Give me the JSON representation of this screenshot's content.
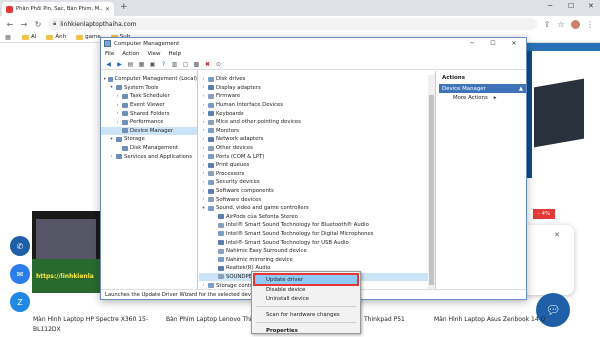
{
  "browser": {
    "tab_title": "Phân Phối Pin, Sạc, Bàn Phím, M...",
    "url": "linhkienlaptopthaiha.com",
    "bookmarks": [
      "AI",
      "Ảnh",
      "game",
      "Sub"
    ]
  },
  "site": {
    "watermark": "https://linhkienla",
    "discount": "- 4%",
    "captions": [
      "Màn Hình Laptop HP Spectre X360 15-",
      "Bàn Phím Laptop Lenovo Think",
      "Thinkpad P51",
      "Màn Hình Laptop Asus Zenbook 14 Q"
    ],
    "caption_line2": "BL112DX"
  },
  "cm": {
    "title": "Computer Management",
    "menu": [
      "File",
      "Action",
      "View",
      "Help"
    ],
    "left_tree": [
      {
        "label": "Computer Management (Local)",
        "level": 0,
        "arrow": "▾"
      },
      {
        "label": "System Tools",
        "level": 1,
        "arrow": "▾"
      },
      {
        "label": "Task Scheduler",
        "level": 2,
        "arrow": "›"
      },
      {
        "label": "Event Viewer",
        "level": 2,
        "arrow": "›"
      },
      {
        "label": "Shared Folders",
        "level": 2,
        "arrow": "›"
      },
      {
        "label": "Performance",
        "level": 2,
        "arrow": "›"
      },
      {
        "label": "Device Manager",
        "level": 2,
        "arrow": "",
        "selected": true
      },
      {
        "label": "Storage",
        "level": 1,
        "arrow": "▾"
      },
      {
        "label": "Disk Management",
        "level": 2,
        "arrow": ""
      },
      {
        "label": "Services and Applications",
        "level": 1,
        "arrow": "›"
      }
    ],
    "device_tree": [
      {
        "label": "Disk drives",
        "level": 0,
        "arrow": "›"
      },
      {
        "label": "Display adapters",
        "level": 0,
        "arrow": "›"
      },
      {
        "label": "Firmware",
        "level": 0,
        "arrow": "›"
      },
      {
        "label": "Human Interface Devices",
        "level": 0,
        "arrow": "›"
      },
      {
        "label": "Keyboards",
        "level": 0,
        "arrow": "›"
      },
      {
        "label": "Mice and other pointing devices",
        "level": 0,
        "arrow": "›"
      },
      {
        "label": "Monitors",
        "level": 0,
        "arrow": "›"
      },
      {
        "label": "Network adapters",
        "level": 0,
        "arrow": "›"
      },
      {
        "label": "Other devices",
        "level": 0,
        "arrow": "›"
      },
      {
        "label": "Ports (COM & LPT)",
        "level": 0,
        "arrow": "›"
      },
      {
        "label": "Print queues",
        "level": 0,
        "arrow": "›"
      },
      {
        "label": "Processors",
        "level": 0,
        "arrow": "›"
      },
      {
        "label": "Security devices",
        "level": 0,
        "arrow": "›"
      },
      {
        "label": "Software components",
        "level": 0,
        "arrow": "›"
      },
      {
        "label": "Software devices",
        "level": 0,
        "arrow": "›"
      },
      {
        "label": "Sound, video and game controllers",
        "level": 0,
        "arrow": "▾"
      },
      {
        "label": "AirPods của Sefonta Stereo",
        "level": 1,
        "arrow": ""
      },
      {
        "label": "Intel® Smart Sound Technology for Bluetooth® Audio",
        "level": 1,
        "arrow": ""
      },
      {
        "label": "Intel® Smart Sound Technology for Digital Microphones",
        "level": 1,
        "arrow": ""
      },
      {
        "label": "Intel® Smart Sound Technology for USB Audio",
        "level": 1,
        "arrow": ""
      },
      {
        "label": "Nahimic Easy Surround device",
        "level": 1,
        "arrow": ""
      },
      {
        "label": "Nahimic mirroring device",
        "level": 1,
        "arrow": ""
      },
      {
        "label": "Realtek(R) Audio",
        "level": 1,
        "arrow": ""
      },
      {
        "label": "SOUNDPEATS",
        "level": 1,
        "arrow": "",
        "selected": true
      },
      {
        "label": "Storage contr",
        "level": 0,
        "arrow": "›"
      },
      {
        "label": "System devic",
        "level": 0,
        "arrow": "›"
      },
      {
        "label": "Universal Seri",
        "level": 0,
        "arrow": "›"
      }
    ],
    "actions": {
      "header": "Actions",
      "selected": "Device Manager",
      "more": "More Actions"
    },
    "status": "Launches the Update Driver Wizard for the selected device."
  },
  "context_menu": {
    "items": [
      "Update driver",
      "Disable device",
      "Uninstall device",
      "Scan for hardware changes",
      "Properties"
    ]
  }
}
